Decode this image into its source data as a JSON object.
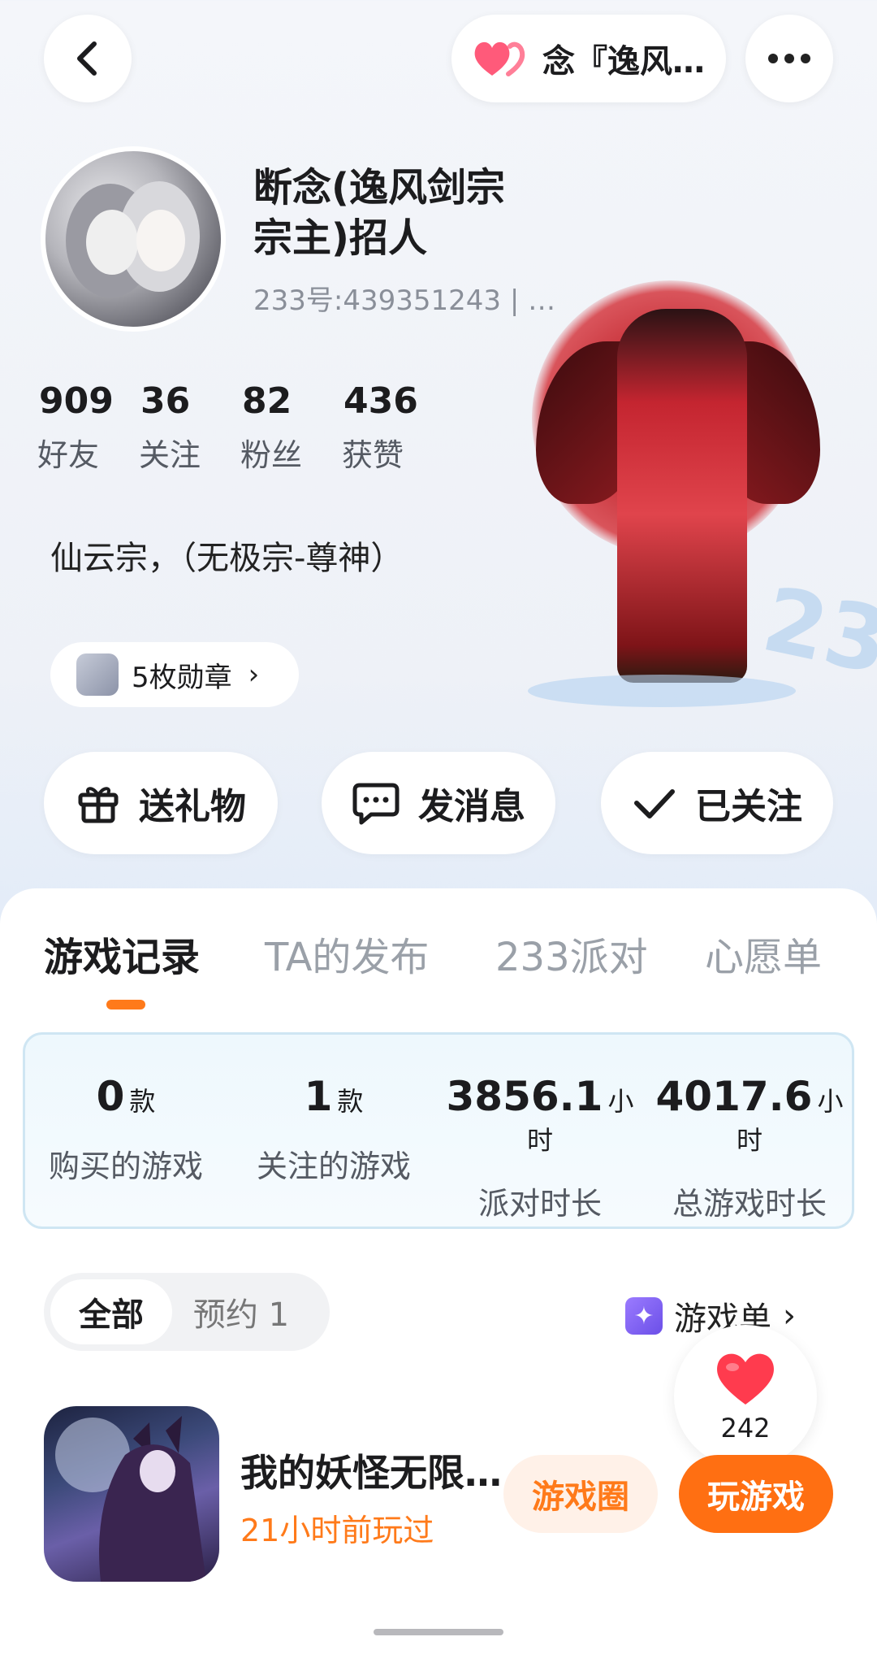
{
  "header": {
    "pill_name": "念『逸风…"
  },
  "profile": {
    "username": "断念(逸风剑宗宗主)招人",
    "uid": "233号:439351243 | …",
    "stats": [
      {
        "value": "909",
        "label": "好友"
      },
      {
        "value": "36",
        "label": "关注"
      },
      {
        "value": "82",
        "label": "粉丝"
      },
      {
        "value": "436",
        "label": "获赞"
      }
    ],
    "bio": "仙云宗，（无极宗-尊神）",
    "badge_label": "5枚勋章",
    "deco_text": "233"
  },
  "actions": {
    "gift": "送礼物",
    "message": "发消息",
    "follow": "已关注"
  },
  "tabs": [
    "游戏记录",
    "TA的发布",
    "233派对",
    "心愿单"
  ],
  "game_stats": [
    {
      "value": "0",
      "unit": "款",
      "label": "购买的游戏"
    },
    {
      "value": "1",
      "unit": "款",
      "label": "关注的游戏"
    },
    {
      "value": "3856.1",
      "unit": "小时",
      "label": "派对时长"
    },
    {
      "value": "4017.6",
      "unit": "小时",
      "label": "总游戏时长"
    }
  ],
  "filter": {
    "all": "全部",
    "reserved": "预约 1",
    "list_label": "游戏单"
  },
  "like_count": "242",
  "game": {
    "name": "我的妖怪无限…",
    "last_played": "21小时前玩过",
    "circle_btn": "游戏圈",
    "play_btn": "玩游戏"
  },
  "colors": {
    "accent": "#ff6f12",
    "heart": "#ff4d6d"
  }
}
